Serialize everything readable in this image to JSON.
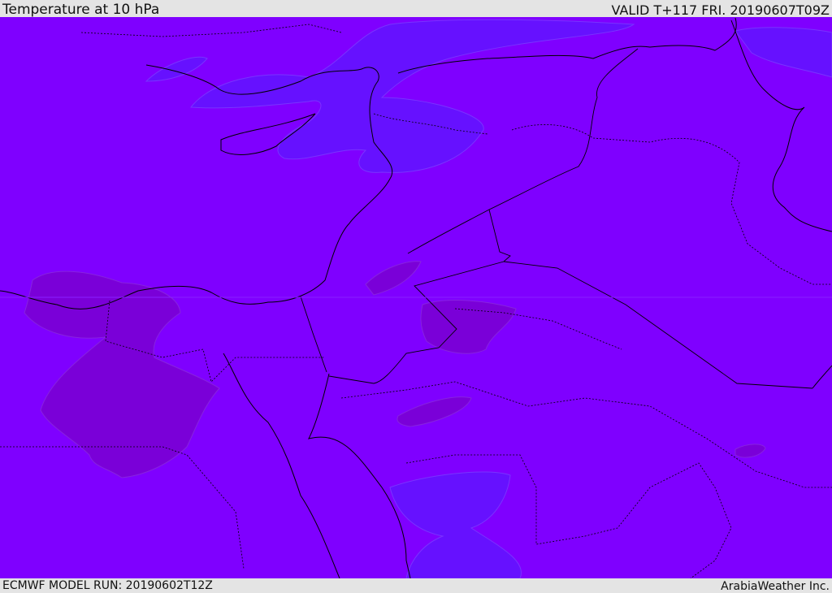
{
  "header": {
    "title": "Temperature at 10 hPa",
    "valid": "VALID T+117 FRI. 20190607T09Z"
  },
  "footer": {
    "model_run": "ECMWF MODEL RUN: 20190602T12Z",
    "credit": "ArabiaWeather Inc."
  },
  "colors": {
    "background": "#7f00ff",
    "warmer_patch": "#7a00d8",
    "cooler_patch": "#6611ff",
    "border": "#000000",
    "frame": "#e4e4e4"
  }
}
